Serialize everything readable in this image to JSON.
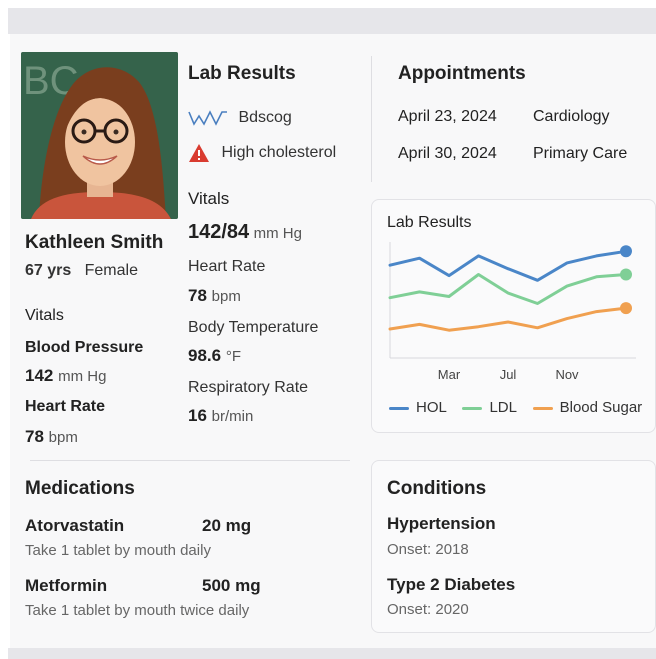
{
  "patient": {
    "name": "Kathleen Smith",
    "age": "67 yrs",
    "sex": "Female",
    "vitals_heading": "Vitals",
    "bp_label": "Blood Pressure",
    "bp_value": "142",
    "bp_unit": "mm Hg",
    "hr_label": "Heart Rate",
    "hr_value": "78",
    "hr_unit": "bpm"
  },
  "lab_results": {
    "heading": "Lab Results",
    "items": [
      {
        "icon": "waveform-icon",
        "label": "Bdscog"
      },
      {
        "icon": "warning-icon",
        "label": "High cholesterol",
        "color": "#d93b30"
      }
    ]
  },
  "vitals": {
    "heading": "Vitals",
    "bp_value": "142/84",
    "bp_unit": "mm Hg",
    "hr_label": "Heart Rate",
    "hr_value": "78",
    "hr_unit": "bpm",
    "temp_label": "Body Temperature",
    "temp_value": "98.6",
    "temp_unit": "°F",
    "rr_label": "Respiratory Rate",
    "rr_value": "16",
    "rr_unit": "br/min"
  },
  "appointments": {
    "heading": "Appointments",
    "items": [
      {
        "date": "April 23, 2024",
        "dept": "Cardiology"
      },
      {
        "date": "April 30, 2024",
        "dept": "Primary Care"
      }
    ]
  },
  "chart_data": {
    "type": "line",
    "title": "Lab Results",
    "x": [
      "",
      "",
      "Mar",
      "",
      "Jul",
      "",
      "Nov",
      "",
      ""
    ],
    "tick_labels": [
      "Mar",
      "Jul",
      "Nov"
    ],
    "series": [
      {
        "name": "HOL",
        "color": "#4a86c8",
        "values": [
          80,
          86,
          71,
          88,
          77,
          67,
          82,
          88,
          92
        ]
      },
      {
        "name": "LDL",
        "color": "#7fcf96",
        "values": [
          52,
          57,
          53,
          72,
          56,
          47,
          62,
          70,
          72
        ]
      },
      {
        "name": "Blood Sugar",
        "color": "#f0a050",
        "values": [
          25,
          29,
          24,
          27,
          31,
          26,
          34,
          40,
          43
        ]
      }
    ],
    "ylim": [
      0,
      100
    ],
    "grid": false,
    "legend": "bottom"
  },
  "medications": {
    "heading": "Medications",
    "items": [
      {
        "name": "Atorvastatin",
        "dose": "20 mg",
        "instructions": "Take 1 tablet by mouth daily"
      },
      {
        "name": "Metformin",
        "dose": "500 mg",
        "instructions": "Take 1 tablet by mouth twice daily"
      }
    ]
  },
  "conditions": {
    "heading": "Conditions",
    "items": [
      {
        "name": "Hypertension",
        "onset": "Onset: 2018"
      },
      {
        "name": "Type 2 Diabetes",
        "onset": "Onset: 2020"
      }
    ]
  }
}
